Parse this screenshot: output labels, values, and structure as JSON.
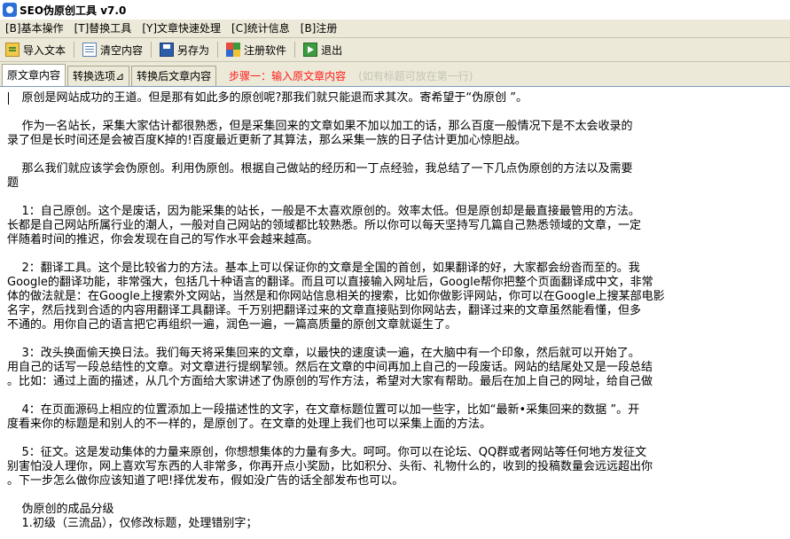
{
  "window": {
    "title": "SEO伪原创工具 v7.0"
  },
  "menubar": [
    "[B]基本操作",
    "[T]替换工具",
    "[Y]文章快速处理",
    "[C]统计信息",
    "[B]注册"
  ],
  "toolbar": {
    "import_label": "导入文本",
    "clear_label": "清空内容",
    "saveas_label": "另存为",
    "register_label": "注册软件",
    "exit_label": "退出"
  },
  "tabs": {
    "original": "原文章内容",
    "options": "转换选项⊿",
    "converted": "转换后文章内容",
    "step": "步骤一：输入原文章内容",
    "hint": "(如有标题可放在第一行)"
  },
  "editor": {
    "lines": [
      "    原创是网站成功的王道。但是那有如此多的原创呢?那我们就只能退而求其次。寄希望于“伪原创 ”。",
      "",
      "    作为一名站长，采集大家估计都很熟悉，但是采集回来的文章如果不加以加工的话，那么百度一般情况下是不太会收录的",
      "录了但是长时间还是会被百度K掉的!百度最近更新了其算法，那么采集一族的日子估计更加心惊胆战。",
      "",
      "    那么我们就应该学会伪原创。利用伪原创。根据自己做站的经历和一丁点经验，我总结了一下几点伪原创的方法以及需要",
      "题",
      "",
      "    1：自己原创。这个是废话，因为能采集的站长，一般是不太喜欢原创的。效率太低。但是原创却是最直接最管用的方法。",
      "长都是自己网站所属行业的潮人，一般对自己网站的领域都比较熟悉。所以你可以每天坚持写几篇自己熟悉领域的文章，一定",
      "伴随着时间的推迟，你会发现在自己的写作水平会越来越高。",
      "",
      "    2：翻译工具。这个是比较省力的方法。基本上可以保证你的文章是全国的首创，如果翻译的好，大家都会纷沓而至的。我",
      "Google的翻译功能，非常强大，包括几十种语言的翻译。而且可以直接输入网址后，Google帮你把整个页面翻译成中文，非常",
      "体的做法就是：在Google上搜索外文网站，当然是和你网站信息相关的搜索，比如你做影评网站，你可以在Google上搜某部电影",
      "名字，然后找到合适的内容用翻译工具翻译。千万别把翻译过来的文章直接贴到你网站去，翻译过来的文章虽然能看懂，但多",
      "不通的。用你自己的语言把它再组织一遍，润色一遍，一篇高质量的原创文章就诞生了。",
      "",
      "    3：改头换面偷天换日法。我们每天将采集回来的文章，以最快的速度读一遍，在大脑中有一个印象，然后就可以开始了。",
      "用自己的话写一段总结性的文章。对文章进行提纲挈领。然后在文章的中间再加上自己的一段废话。网站的结尾处又是一段总结",
      "。比如：通过上面的描述，从几个方面给大家讲述了伪原创的写作方法，希望对大家有帮助。最后在加上自己的网址，给自己做",
      "",
      "    4：在页面源码上相应的位置添加上一段描述性的文字，在文章标题位置可以加一些字，比如“最新•采集回来的数据 ”。开",
      "度看来你的标题是和别人的不一样的，是原创了。在文章的处理上我们也可以采集上面的方法。",
      "",
      "    5：征文。这是发动集体的力量来原创，你想想集体的力量有多大。呵呵。你可以在论坛、QQ群或者网站等任何地方发征文",
      "别害怕没人理你，网上喜欢写东西的人非常多，你再开点小奖励，比如积分、头衔、礼物什么的，收到的投稿数量会远远超出你",
      "。下一步怎么做你应该知道了吧!择优发布，假如没广告的话全部发布也可以。",
      "",
      "    伪原创的成品分级",
      "    1.初级（三流品），仅修改标题，处理错别字；"
    ]
  }
}
